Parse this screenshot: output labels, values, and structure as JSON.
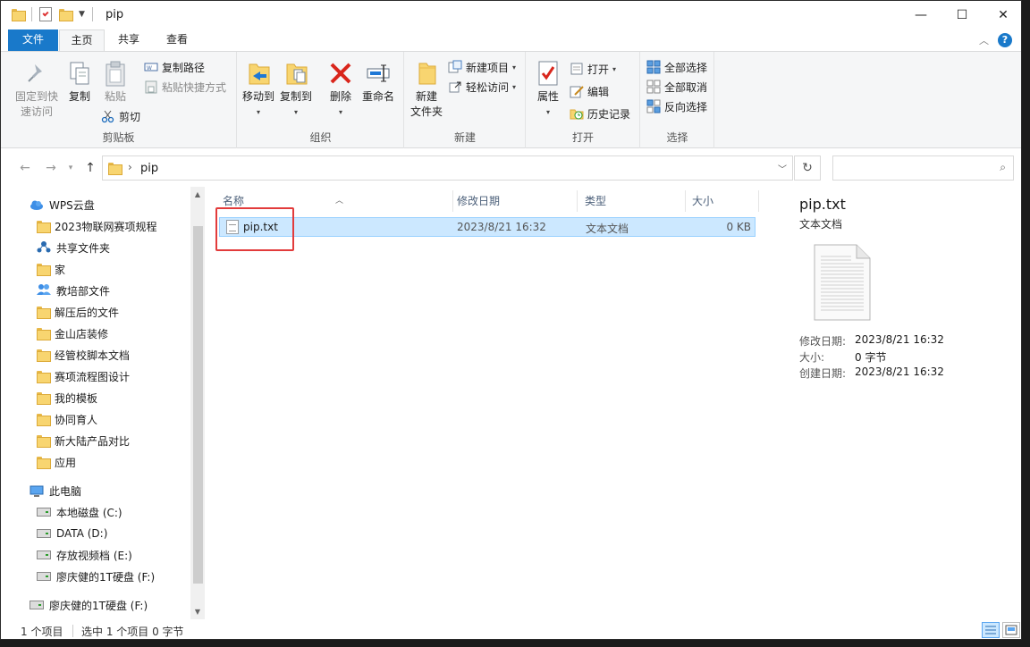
{
  "window": {
    "title": "pip",
    "minimize": "—",
    "maximize": "☐",
    "close": "✕"
  },
  "tabs": [
    "文件",
    "主页",
    "共享",
    "查看"
  ],
  "ribbon": {
    "clipboard": {
      "label": "剪贴板",
      "pin_line1": "固定到快",
      "pin_line2": "速访问",
      "copy": "复制",
      "paste": "粘贴",
      "copy_path": "复制路径",
      "paste_shortcut": "粘贴快捷方式",
      "cut": "剪切"
    },
    "organize": {
      "label": "组织",
      "move_to": "移动到",
      "copy_to": "复制到",
      "delete": "删除",
      "rename": "重命名"
    },
    "new": {
      "label": "新建",
      "new_folder_line1": "新建",
      "new_folder_line2": "文件夹",
      "new_item": "新建项目",
      "easy_access": "轻松访问"
    },
    "open": {
      "label": "打开",
      "properties": "属性",
      "open": "打开",
      "edit": "编辑",
      "history": "历史记录"
    },
    "select": {
      "label": "选择",
      "select_all": "全部选择",
      "select_none": "全部取消",
      "invert": "反向选择"
    }
  },
  "address": {
    "path": "pip",
    "search_placeholder": ""
  },
  "nav": {
    "cloud": "WPS云盘",
    "items": [
      "2023物联网赛项规程",
      "共享文件夹",
      "家",
      "教培部文件",
      "解压后的文件",
      "金山店装修",
      "经管校脚本文档",
      "赛项流程图设计",
      "我的模板",
      "协同育人",
      "新大陆产品对比",
      "应用"
    ],
    "this_pc": "此电脑",
    "drives": [
      "本地磁盘 (C:)",
      "DATA (D:)",
      "存放视频档 (E:)",
      "廖庆健的1T硬盘 (F:)"
    ],
    "external": "廖庆健的1T硬盘 (F:)"
  },
  "columns": {
    "name": "名称",
    "date": "修改日期",
    "type": "类型",
    "size": "大小"
  },
  "files": [
    {
      "name": "pip.txt",
      "date": "2023/8/21 16:32",
      "type": "文本文档",
      "size": "0 KB"
    }
  ],
  "preview": {
    "title": "pip.txt",
    "type": "文本文档",
    "modified_label": "修改日期:",
    "modified_value": "2023/8/21 16:32",
    "size_label": "大小:",
    "size_value": "0 字节",
    "created_label": "创建日期:",
    "created_value": "2023/8/21 16:32"
  },
  "status": {
    "count": "1 个项目",
    "selected": "选中 1 个项目  0 字节"
  },
  "colors": {
    "accent": "#1979ca",
    "selection": "#cce8ff",
    "highlight": "#e23b3b",
    "folder": "#f8d570"
  }
}
